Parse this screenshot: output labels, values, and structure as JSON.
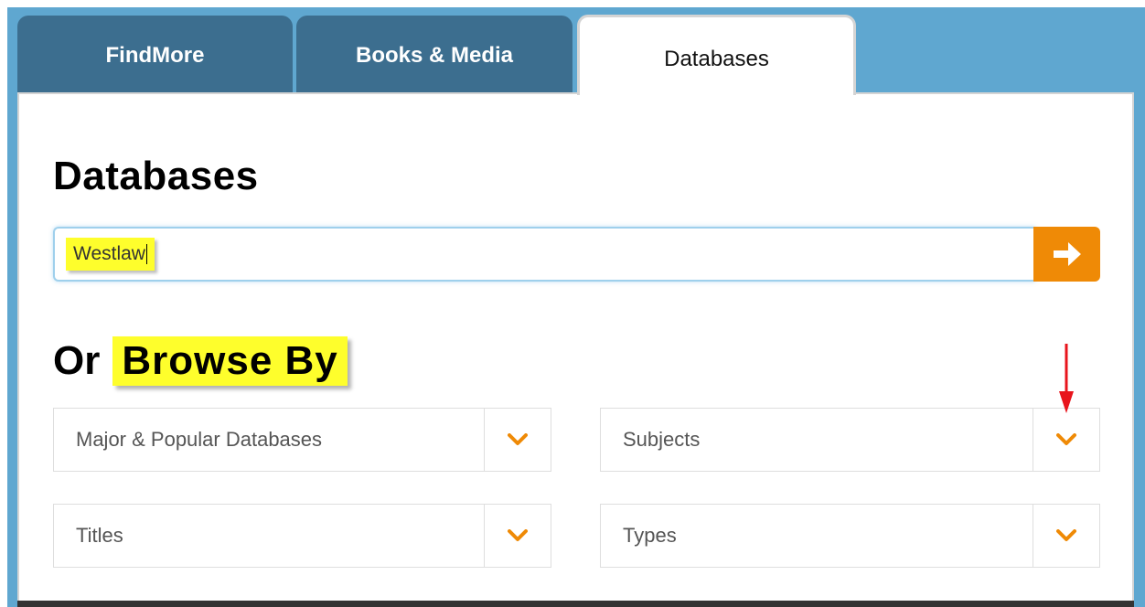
{
  "tabs": [
    {
      "label": "FindMore"
    },
    {
      "label": "Books & Media"
    },
    {
      "label": "Databases"
    }
  ],
  "main": {
    "heading": "Databases",
    "search_value": "Westlaw",
    "browse_prefix": "Or",
    "browse_highlight": "Browse By"
  },
  "browse": [
    {
      "label": "Major & Popular Databases"
    },
    {
      "label": "Subjects"
    },
    {
      "label": "Titles"
    },
    {
      "label": "Types"
    }
  ],
  "icons": {
    "search_button": "arrow-right-icon",
    "dropdown": "chevron-down-icon",
    "annotation": "red-arrow-down"
  },
  "colors": {
    "tab_inactive": "#3c6e8f",
    "background": "#5fa7d0",
    "accent_orange": "#ef8a06",
    "highlight_yellow": "#fefe2c",
    "annotation_red": "#e8141c"
  }
}
